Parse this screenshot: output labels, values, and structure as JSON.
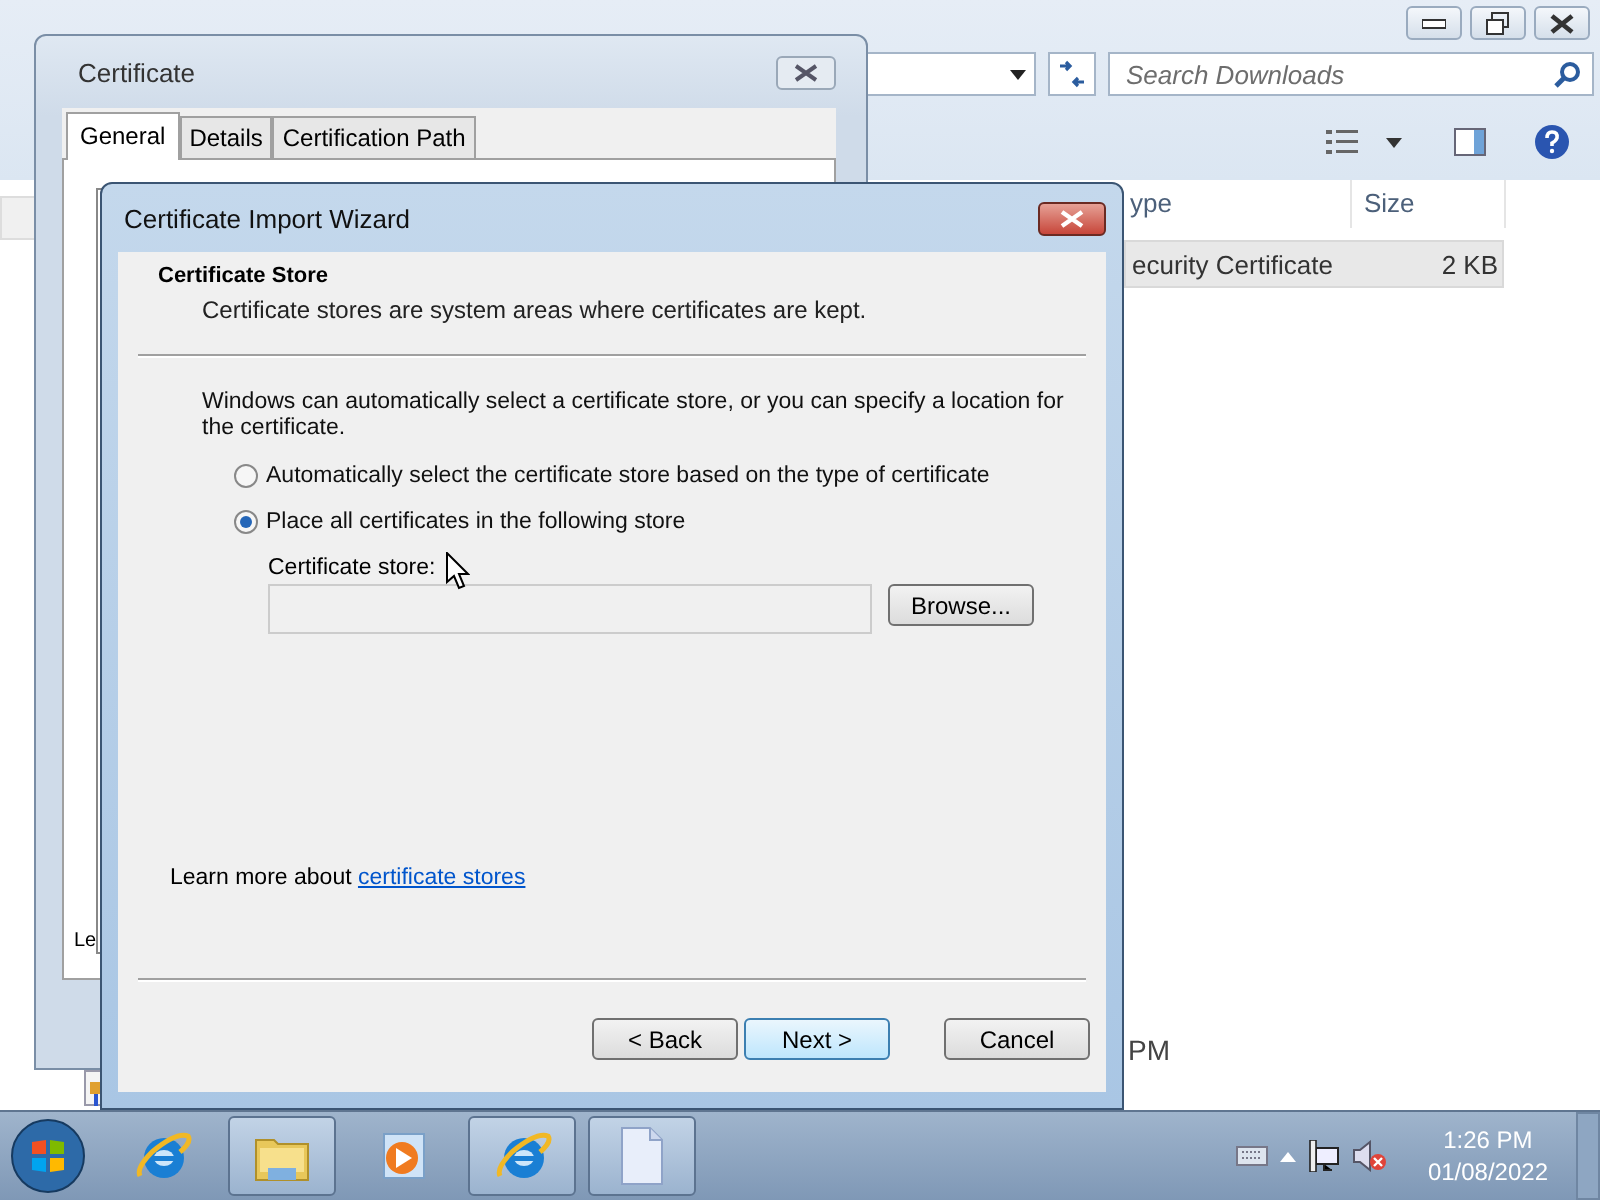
{
  "explorer": {
    "search": {
      "placeholder": "Search Downloads"
    },
    "columns": [
      {
        "label": "ype"
      },
      {
        "label": "Size"
      }
    ],
    "rows": [
      {
        "type": "ecurity Certificate",
        "size": "2 KB",
        "selected": true
      }
    ],
    "footer_text": "PM"
  },
  "certificate_window": {
    "title": "Certificate",
    "tabs": [
      {
        "label": "General",
        "selected": true
      },
      {
        "label": "Details",
        "selected": false
      },
      {
        "label": "Certification Path",
        "selected": false
      }
    ],
    "partial_text": "Le"
  },
  "wizard": {
    "title": "Certificate Import Wizard",
    "heading": "Certificate Store",
    "subheading": "Certificate stores are system areas where certificates are kept.",
    "intro": "Windows can automatically select a certificate store, or you can specify a location for the certificate.",
    "options": [
      {
        "label": "Automatically select the certificate store based on the type of certificate",
        "selected": false
      },
      {
        "label": "Place all certificates in the following store",
        "selected": true
      }
    ],
    "store_label": "Certificate store:",
    "browse_button": "Browse...",
    "learn_more": {
      "text": "Learn more about",
      "link": "certificate stores"
    },
    "buttons": [
      {
        "label": "< Back",
        "default": false
      },
      {
        "label": "Next >",
        "default": true
      },
      {
        "label": "Cancel",
        "default": false
      }
    ]
  },
  "taskbar": {
    "apps": [
      {
        "kind": "browser",
        "active": false
      },
      {
        "kind": "folder",
        "active": true
      },
      {
        "kind": "media",
        "active": false
      },
      {
        "kind": "browser",
        "active": true
      },
      {
        "kind": "document",
        "active": true
      }
    ],
    "time": "1:26 PM",
    "date": "01/08/2022"
  }
}
